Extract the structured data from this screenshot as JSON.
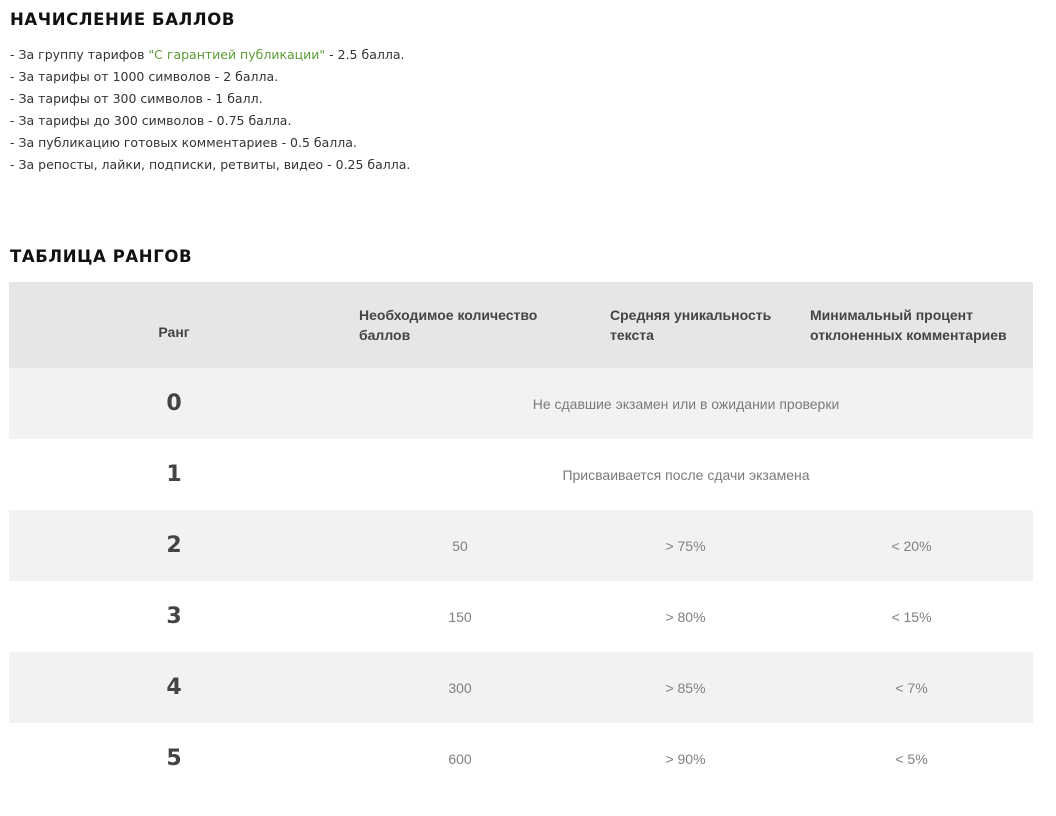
{
  "points_section": {
    "title": "НАЧИСЛЕНИЕ БАЛЛОВ",
    "rules": [
      {
        "prefix": "- За группу тарифов ",
        "highlight": "\"С гарантией публикации\"",
        "suffix": " - 2.5 балла.",
        "highlight_color": "#5b9b35"
      },
      {
        "text": "- За тарифы от 1000 символов - 2 балла."
      },
      {
        "text": "- За тарифы от 300 символов - 1 балл."
      },
      {
        "text": "- За тарифы до 300 символов - 0.75 балла."
      },
      {
        "text": "- За публикацию готовых комментариев - 0.5 балла."
      },
      {
        "text": "- За репосты, лайки, подписки, ретвиты, видео - 0.25 балла."
      }
    ]
  },
  "ranks_section": {
    "title": "ТАБЛИЦА РАНГОВ",
    "columns": [
      "Ранг",
      "Необходимое количество баллов",
      "Средняя уникальность текста",
      "Минимальный процент отклоненных комментариев"
    ],
    "rows": [
      {
        "rank": "0",
        "note": "Не сдавшие экзамен или в ожидании проверки"
      },
      {
        "rank": "1",
        "note": "Присваивается после сдачи экзамена"
      },
      {
        "rank": "2",
        "points": "50",
        "uniqueness": "> 75%",
        "rejected": "< 20%"
      },
      {
        "rank": "3",
        "points": "150",
        "uniqueness": "> 80%",
        "rejected": "< 15%"
      },
      {
        "rank": "4",
        "points": "300",
        "uniqueness": "> 85%",
        "rejected": "< 7%"
      },
      {
        "rank": "5",
        "points": "600",
        "uniqueness": "> 90%",
        "rejected": "< 5%"
      }
    ]
  },
  "colors": {
    "header_bg": "#e6e6e6",
    "row_odd_bg": "#f2f2f2",
    "row_even_bg": "#ffffff",
    "highlight": "#5b9b35"
  }
}
